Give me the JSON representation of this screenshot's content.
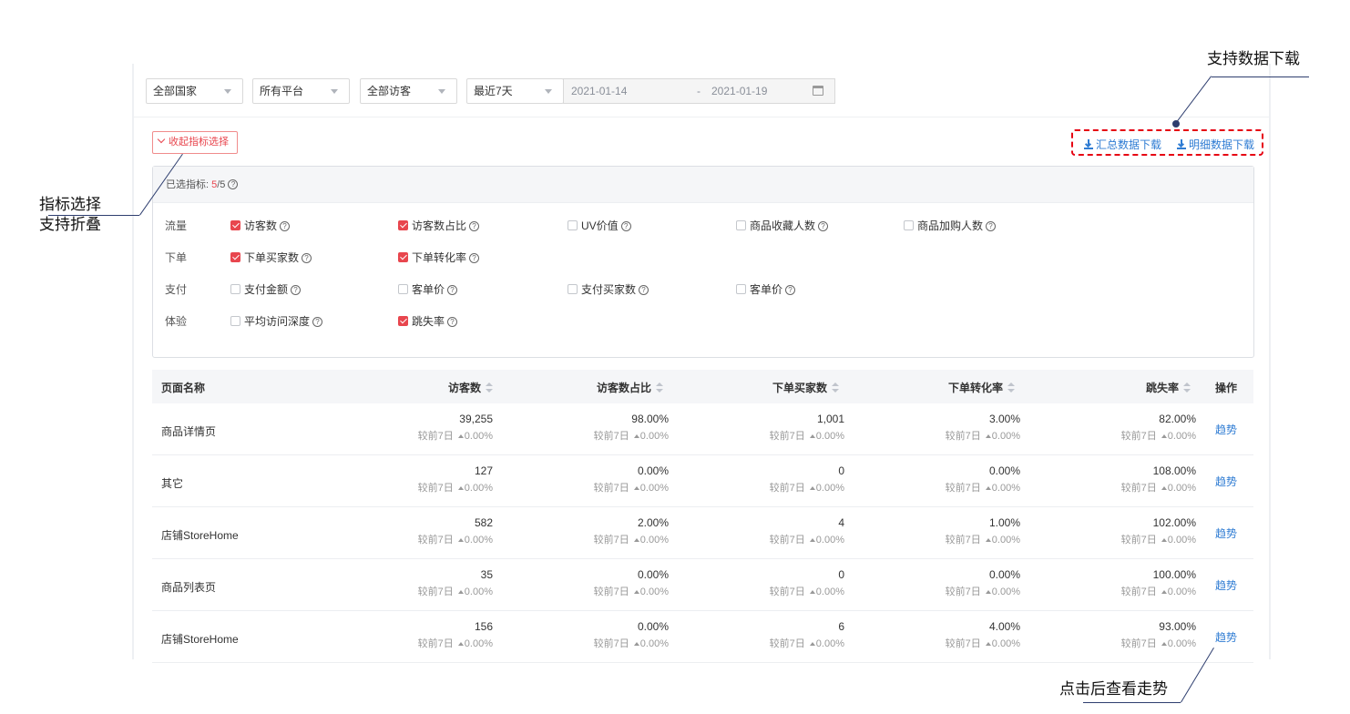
{
  "filters": {
    "country": "全部国家",
    "platform": "所有平台",
    "visitor": "全部访客",
    "period": "最近7天",
    "date_start": "2021-01-14",
    "date_sep": "-",
    "date_end": "2021-01-19"
  },
  "collapse_label": "收起指标选择",
  "downloads": {
    "summary": "汇总数据下载",
    "detail": "明细数据下载"
  },
  "metrics": {
    "selected_label": "已选指标:",
    "selected_count": "5",
    "selected_total": "/5",
    "rows": [
      {
        "label": "流量",
        "items": [
          {
            "text": "访客数",
            "checked": true
          },
          {
            "text": "访客数占比",
            "checked": true
          },
          {
            "text": "UV价值",
            "checked": false
          },
          {
            "text": "商品收藏人数",
            "checked": false
          },
          {
            "text": "商品加购人数",
            "checked": false
          }
        ]
      },
      {
        "label": "下单",
        "items": [
          {
            "text": "下单买家数",
            "checked": true
          },
          {
            "text": "下单转化率",
            "checked": true
          }
        ]
      },
      {
        "label": "支付",
        "items": [
          {
            "text": "支付金额",
            "checked": false
          },
          {
            "text": "客单价",
            "checked": false
          },
          {
            "text": "支付买家数",
            "checked": false
          },
          {
            "text": "客单价",
            "checked": false
          }
        ]
      },
      {
        "label": "体验",
        "items": [
          {
            "text": "平均访问深度",
            "checked": false
          },
          {
            "text": "跳失率",
            "checked": true
          }
        ]
      }
    ]
  },
  "table": {
    "headers": {
      "name": "页面名称",
      "visitors": "访客数",
      "share": "访客数占比",
      "buyers": "下单买家数",
      "conversion": "下单转化率",
      "bounce": "跳失率",
      "action": "操作"
    },
    "compare_label": "较前7日",
    "trend_label": "趋势",
    "rows": [
      {
        "name": "商品详情页",
        "visitors": "39,255",
        "share": "98.00%",
        "buyers": "1,001",
        "conversion": "3.00%",
        "bounce": "82.00%",
        "delta": "0.00%"
      },
      {
        "name": "其它",
        "visitors": "127",
        "share": "0.00%",
        "buyers": "0",
        "conversion": "0.00%",
        "bounce": "108.00%",
        "delta": "0.00%"
      },
      {
        "name": "店铺StoreHome",
        "visitors": "582",
        "share": "2.00%",
        "buyers": "4",
        "conversion": "1.00%",
        "bounce": "102.00%",
        "delta": "0.00%"
      },
      {
        "name": "商品列表页",
        "visitors": "35",
        "share": "0.00%",
        "buyers": "0",
        "conversion": "0.00%",
        "bounce": "100.00%",
        "delta": "0.00%"
      },
      {
        "name": "店铺StoreHome",
        "visitors": "156",
        "share": "0.00%",
        "buyers": "6",
        "conversion": "4.00%",
        "bounce": "93.00%",
        "delta": "0.00%"
      }
    ]
  },
  "annotations": {
    "download": "支持数据下载",
    "metric_line1": "指标选择",
    "metric_line2": "支持折叠",
    "trend": "点击后查看走势"
  },
  "colors": {
    "accent_red": "#e8464e",
    "link_blue": "#2f7cd3",
    "annotation_box": "#e60012",
    "annotation_line": "#2e3e6f"
  }
}
